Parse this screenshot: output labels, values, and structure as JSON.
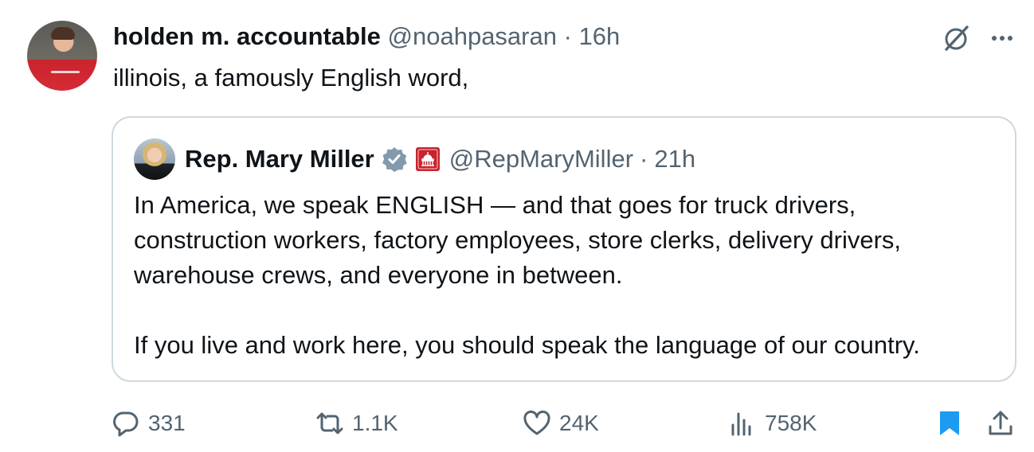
{
  "author": {
    "name": "holden m. accountable",
    "handle": "@noahpasaran",
    "separator": "·",
    "time": "16h"
  },
  "tweet": {
    "text": "illinois, a famously English word,"
  },
  "quote": {
    "name": "Rep. Mary Miller",
    "handle": "@RepMaryMiller",
    "separator": "·",
    "time": "21h",
    "lines": [
      "In America, we speak ENGLISH — and that goes for truck drivers,",
      "construction workers, factory employees, store clerks, delivery drivers,",
      "warehouse crews, and everyone in between.",
      "If you live and work here, you should speak the language of our country."
    ]
  },
  "actions": {
    "replies": "331",
    "reposts": "1.1K",
    "likes": "24K",
    "views": "758K"
  },
  "icons": {
    "grok": "grok-icon",
    "more": "more-icon",
    "verified": "verified-badge-icon",
    "affiliation": "capitol-icon",
    "reply": "reply-icon",
    "repost": "repost-icon",
    "like": "heart-icon",
    "views": "views-icon",
    "bookmark": "bookmark-icon",
    "share": "share-icon"
  },
  "colors": {
    "text": "#0f1419",
    "secondary": "#536471",
    "border": "#cfd9de",
    "bookmark": "#1d9bf0",
    "verified": "#829aab",
    "affiliation": "#c8242d"
  }
}
